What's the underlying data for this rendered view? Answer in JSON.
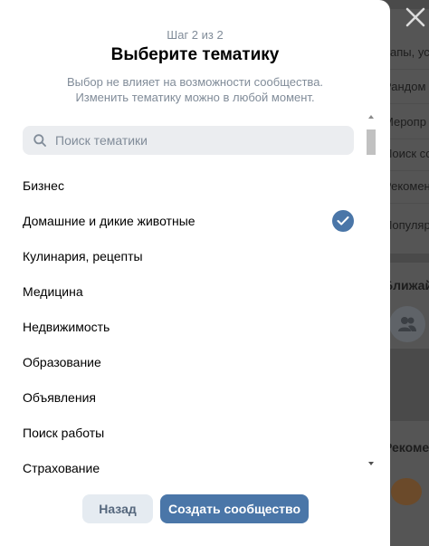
{
  "modal": {
    "step": "Шаг 2 из 2",
    "title": "Выберите тематику",
    "subtitle_line1": "Выбор не влияет на возможности сообщества.",
    "subtitle_line2": "Изменить тематику можно в любой момент.",
    "search_placeholder": "Поиск тематики",
    "topics": [
      {
        "label": "Бизнес",
        "selected": false
      },
      {
        "label": "Домашние и дикие животные",
        "selected": true
      },
      {
        "label": "Кулинария, рецепты",
        "selected": false
      },
      {
        "label": "Медицина",
        "selected": false
      },
      {
        "label": "Недвижимость",
        "selected": false
      },
      {
        "label": "Образование",
        "selected": false
      },
      {
        "label": "Объявления",
        "selected": false
      },
      {
        "label": "Поиск работы",
        "selected": false
      },
      {
        "label": "Страхование",
        "selected": false
      }
    ],
    "back_label": "Назад",
    "create_label": "Создать сообщество"
  },
  "background": {
    "lines": [
      "папы, ус",
      "Рандом",
      "Меропр",
      "Поиск со",
      "Рекомен",
      "Популяр"
    ],
    "section1": "Ближай",
    "section2": "Рекоме"
  },
  "colors": {
    "accent": "#4a76a8",
    "secondary_button": "#e5ebf1",
    "secondary_text": "#818c99"
  }
}
